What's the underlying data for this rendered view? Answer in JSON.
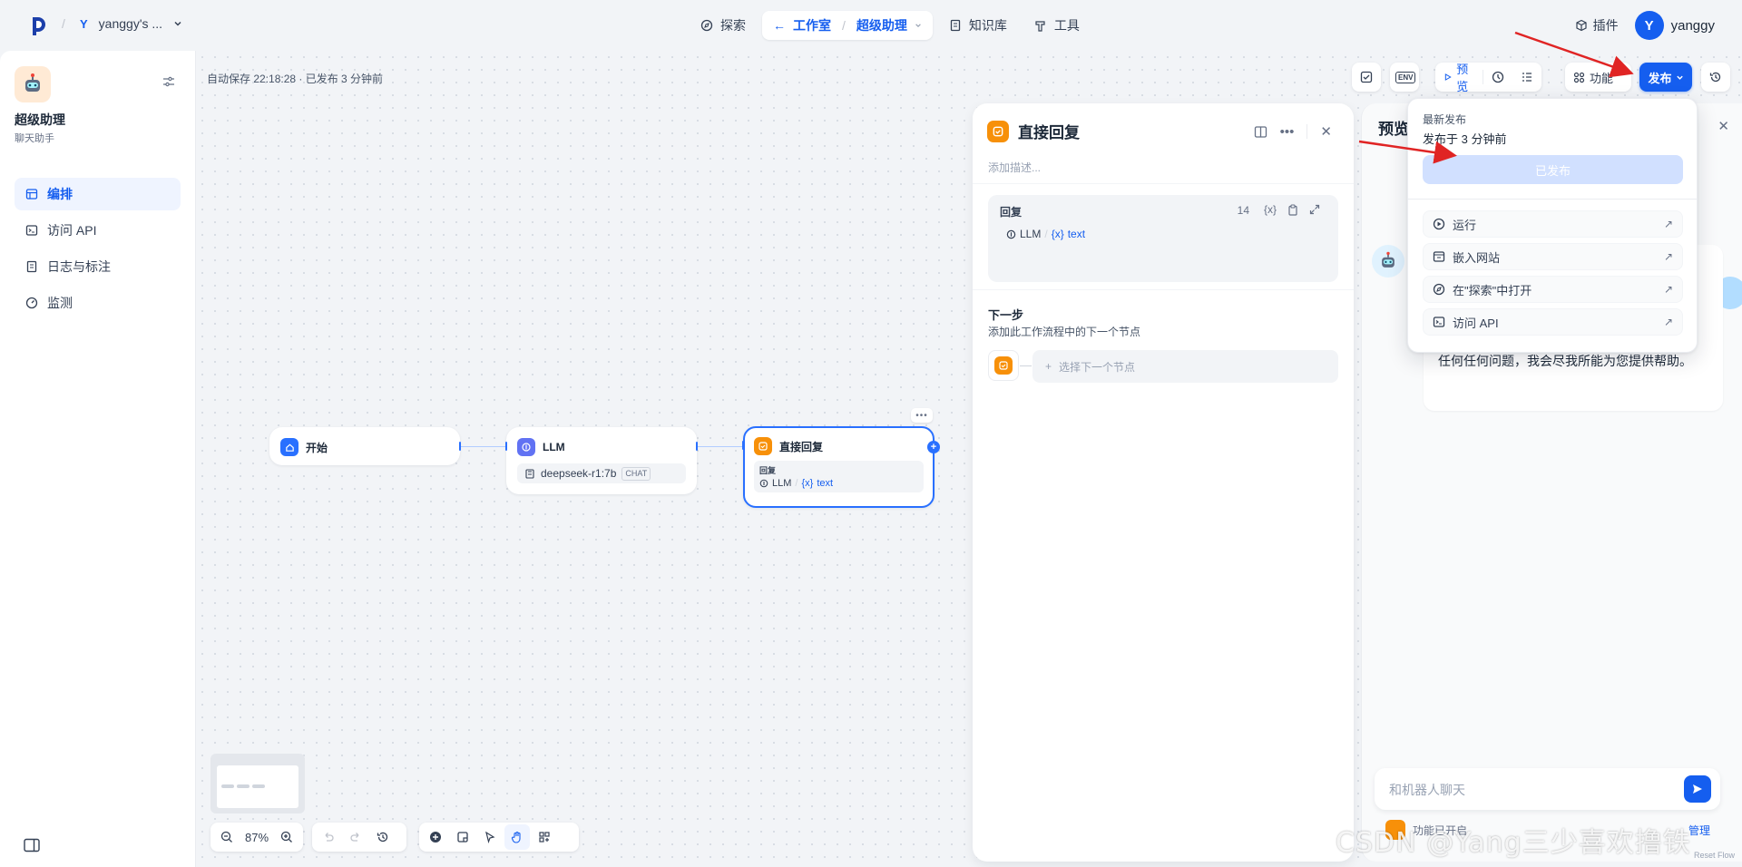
{
  "workspace": {
    "letter": "Y",
    "name": "yanggy's ..."
  },
  "nav": {
    "explore": "探索",
    "studio": "工作室",
    "app": "超级助理",
    "knowledge": "知识库",
    "tools": "工具"
  },
  "topright": {
    "plugins": "插件",
    "avatar_letter": "Y",
    "username": "yanggy"
  },
  "app": {
    "name": "超级助理",
    "type": "聊天助手"
  },
  "sidebar": {
    "items": [
      {
        "label": "编排",
        "icon": "layout-icon",
        "active": true
      },
      {
        "label": "访问 API",
        "icon": "terminal-icon",
        "active": false
      },
      {
        "label": "日志与标注",
        "icon": "document-icon",
        "active": false
      },
      {
        "label": "监测",
        "icon": "gauge-icon",
        "active": false
      }
    ]
  },
  "canvas": {
    "autosave": "自动保存 22:18:28 · 已发布 3 分钟前"
  },
  "toolbar": {
    "env": "ENV",
    "preview": "预览",
    "features": "功能",
    "publish": "发布"
  },
  "nodes": {
    "start": {
      "title": "开始"
    },
    "llm": {
      "title": "LLM",
      "model": "deepseek-r1:7b",
      "mode": "CHAT"
    },
    "answer": {
      "title": "直接回复",
      "reply_label": "回复",
      "var_node": "LLM",
      "var_name": "text"
    }
  },
  "zoom": {
    "level": "87%"
  },
  "node_panel": {
    "title": "直接回复",
    "description_placeholder": "添加描述...",
    "reply": {
      "label": "回复",
      "count": "14",
      "var_node": "LLM",
      "var_name": "text"
    },
    "next_step": {
      "title": "下一步",
      "subtitle": "添加此工作流程中的下一个节点",
      "select": "选择下一个节点"
    }
  },
  "preview": {
    "title": "预览",
    "bot_message_visible": "任何任何问题，我会尽我所能为您提供帮助。",
    "input_placeholder": "和机器人聊天",
    "features_label": "功能已开启",
    "manage": "管理",
    "reset": "Reset Flow"
  },
  "publish_menu": {
    "latest_label": "最新发布",
    "published_time": "发布于 3 分钟前",
    "published_button": "已发布",
    "items": [
      {
        "label": "运行",
        "icon": "play-circle-icon"
      },
      {
        "label": "嵌入网站",
        "icon": "embed-icon"
      },
      {
        "label": "在\"探索\"中打开",
        "icon": "compass-icon"
      },
      {
        "label": "访问 API",
        "icon": "terminal-icon"
      }
    ]
  },
  "watermark": "CSDN @Yang三少喜欢撸铁",
  "colors": {
    "primary": "#155eef",
    "accent_orange": "#f79009",
    "annotation_red": "#e02424"
  }
}
